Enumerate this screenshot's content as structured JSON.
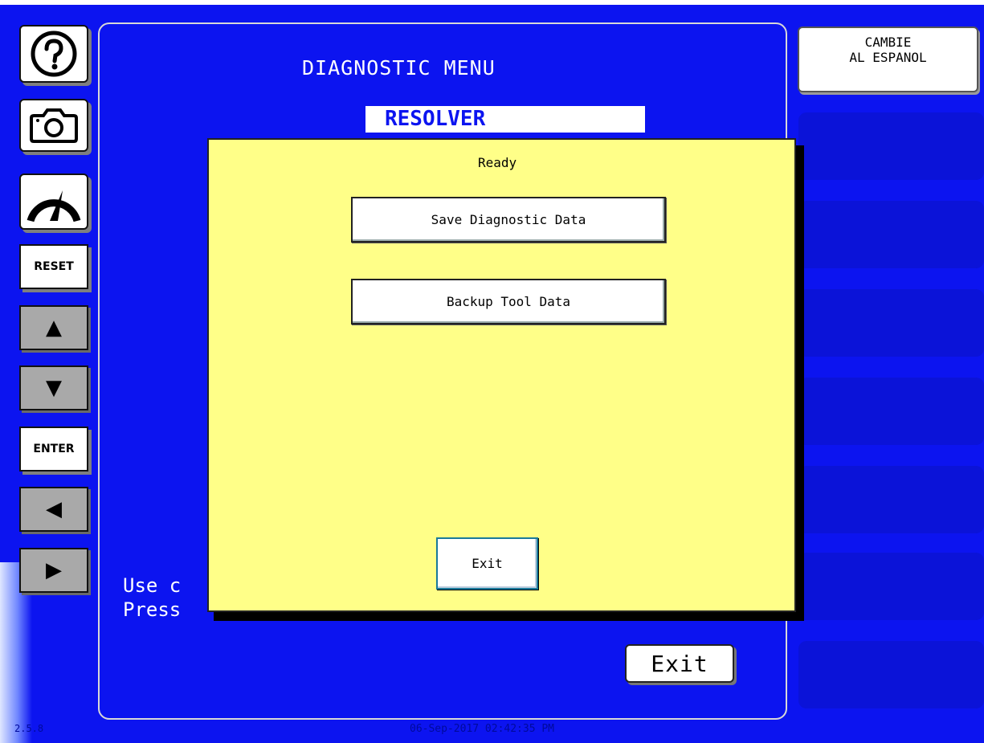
{
  "toolbar": {
    "reset_label": "RESET",
    "enter_label": "ENTER",
    "up_arrow": "▲",
    "down_arrow": "▼",
    "left_arrow": "◀",
    "right_arrow": "▶"
  },
  "main": {
    "title": "DIAGNOSTIC MENU",
    "selected_item": "RESOLVER",
    "instruction_line1": "Use c",
    "instruction_line2": "Press",
    "exit_label": "Exit"
  },
  "right_panel": {
    "language_button": {
      "line1": "CAMBIE",
      "line2": "AL ESPANOL"
    }
  },
  "modal": {
    "status": "Ready",
    "save_button": "Save Diagnostic Data",
    "backup_button": "Backup Tool Data",
    "exit_label": "Exit"
  },
  "footer": {
    "version": "2.5.8",
    "datetime": "06-Sep-2017 02:42:35 PM"
  },
  "colors": {
    "background": "#0c14f0",
    "modal_background": "#ffff88",
    "slot": "#0b13d8"
  },
  "icons": [
    "help-icon",
    "camera-icon",
    "gauge-icon"
  ]
}
